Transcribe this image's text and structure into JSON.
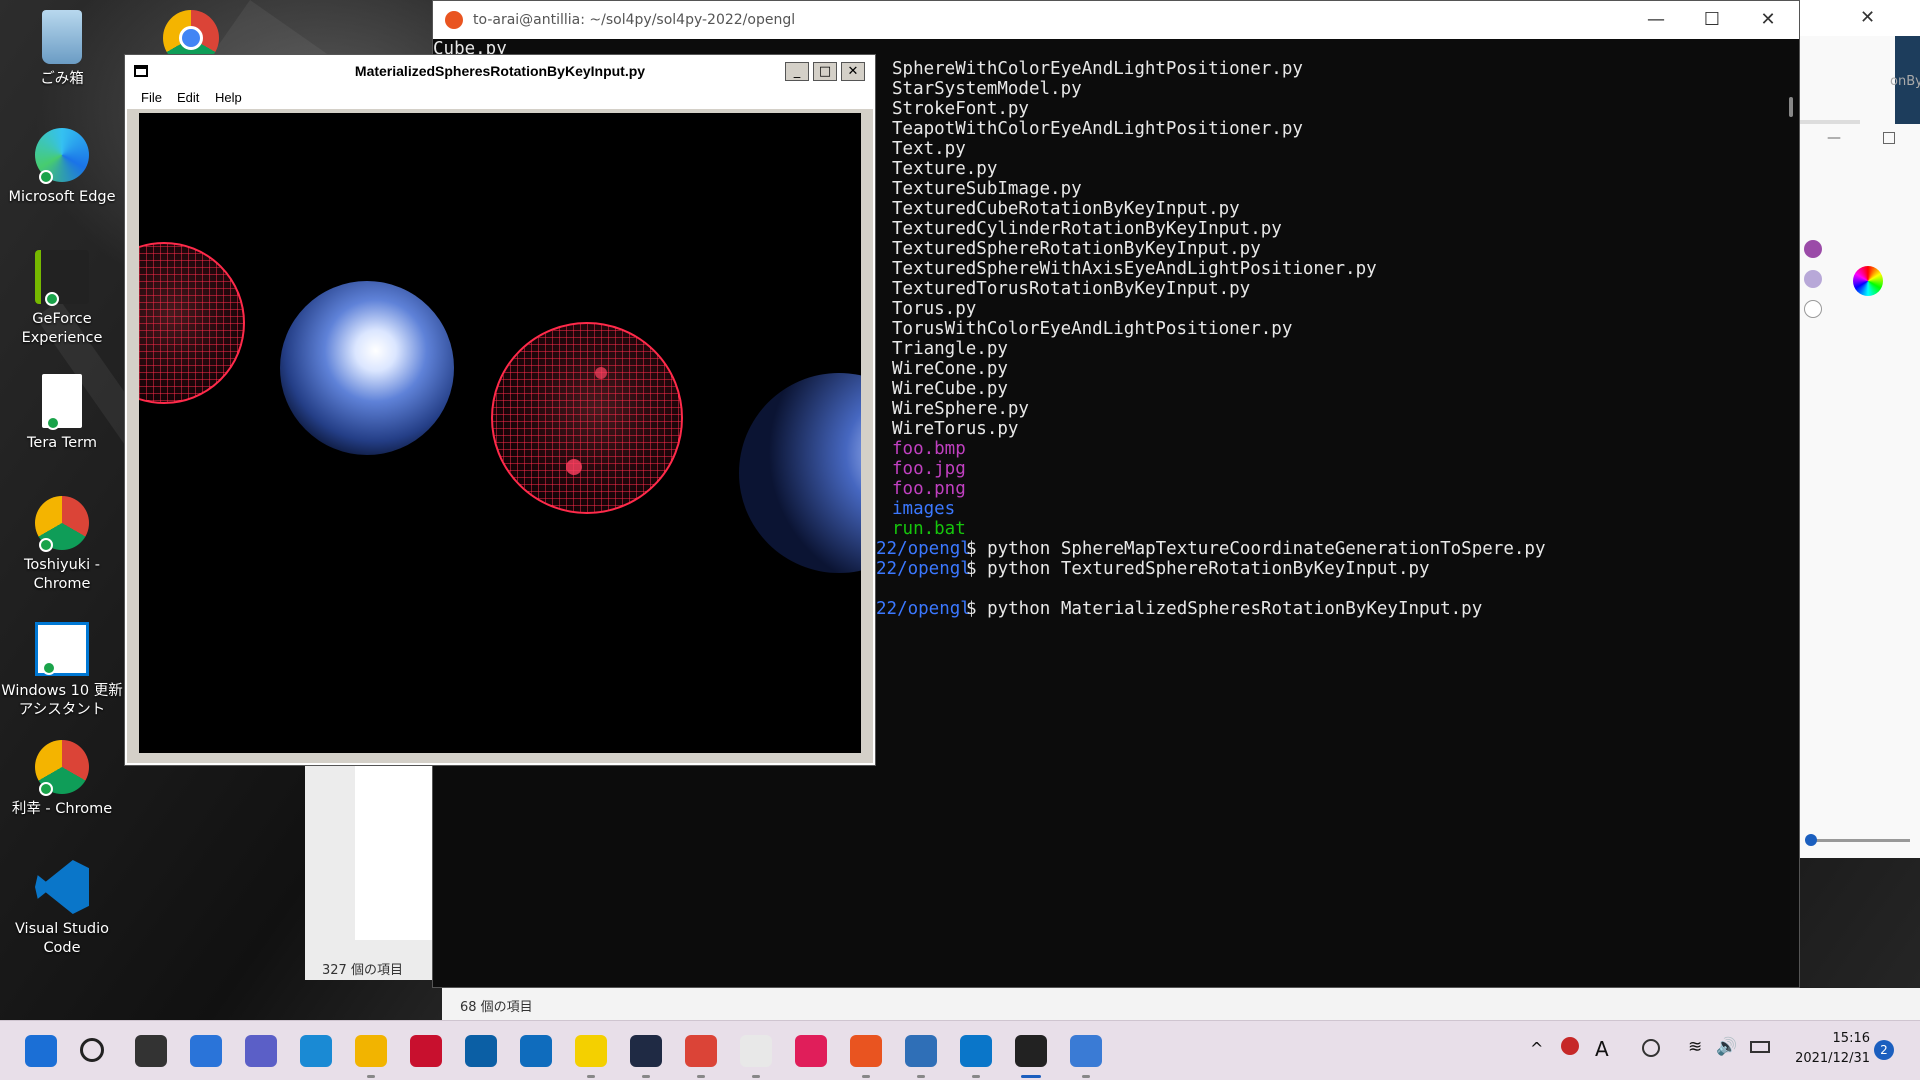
{
  "desktop": {
    "icons": [
      {
        "label": "ごみ箱",
        "icon": "recycle-bin-icon"
      },
      {
        "label": "Microsoft Edge",
        "icon": "edge-icon"
      },
      {
        "label": "GeForce\nExperience",
        "icon": "geforce-icon"
      },
      {
        "label": "Tera Term",
        "icon": "document-icon"
      },
      {
        "label": "Toshiyuki -\nChrome",
        "icon": "chrome-icon"
      },
      {
        "label": "Windows 10 更新\nアシスタント",
        "icon": "windows-update-icon"
      },
      {
        "label": "利幸 - Chrome",
        "icon": "chrome-icon"
      },
      {
        "label": "Visual Studio\nCode",
        "icon": "vscode-icon"
      }
    ]
  },
  "explorer": {
    "status_back": "327 個の項目",
    "status_front": "68 個の項目"
  },
  "terminal": {
    "title": "to-arai@antillia: ~/sol4py/sol4py-2022/opengl",
    "lines": [
      {
        "text": "Cube.py",
        "col": 0,
        "color": "#e8e8e8"
      },
      {
        "text": "SphereWithColorEyeAndLightPositioner.py",
        "col": 1,
        "color": "#e8e8e8"
      },
      {
        "text": "StarSystemModel.py",
        "col": 1,
        "color": "#e8e8e8"
      },
      {
        "text": "StrokeFont.py",
        "col": 1,
        "color": "#e8e8e8"
      },
      {
        "text": "TeapotWithColorEyeAndLightPositioner.py",
        "col": 1,
        "color": "#e8e8e8"
      },
      {
        "text": "Text.py",
        "col": 1,
        "color": "#e8e8e8"
      },
      {
        "text": "Texture.py",
        "col": 1,
        "color": "#e8e8e8"
      },
      {
        "text": "TextureSubImage.py",
        "col": 1,
        "color": "#e8e8e8"
      },
      {
        "text": "TexturedCubeRotationByKeyInput.py",
        "col": 1,
        "color": "#e8e8e8"
      },
      {
        "text": "TexturedCylinderRotationByKeyInput.py",
        "col": 1,
        "color": "#e8e8e8"
      },
      {
        "text": "TexturedSphereRotationByKeyInput.py",
        "col": 1,
        "color": "#e8e8e8"
      },
      {
        "text": "TexturedSphereWithAxisEyeAndLightPositioner.py",
        "col": 1,
        "color": "#e8e8e8"
      },
      {
        "text": "TexturedTorusRotationByKeyInput.py",
        "col": 1,
        "color": "#e8e8e8"
      },
      {
        "text": "Torus.py",
        "col": 1,
        "color": "#e8e8e8"
      },
      {
        "text": "TorusWithColorEyeAndLightPositioner.py",
        "col": 1,
        "color": "#e8e8e8"
      },
      {
        "text": "Triangle.py",
        "col": 1,
        "color": "#e8e8e8"
      },
      {
        "text": "WireCone.py",
        "col": 1,
        "color": "#e8e8e8"
      },
      {
        "text": "WireCube.py",
        "col": 1,
        "color": "#e8e8e8"
      },
      {
        "text": "WireSphere.py",
        "col": 1,
        "color": "#e8e8e8"
      },
      {
        "text": "WireTorus.py",
        "col": 1,
        "color": "#e8e8e8"
      },
      {
        "text": "foo.bmp",
        "col": 1,
        "color": "#c040c0"
      },
      {
        "text": "foo.jpg",
        "col": 1,
        "color": "#c040c0"
      },
      {
        "text": "foo.png",
        "col": 1,
        "color": "#c040c0"
      },
      {
        "text": "images",
        "col": 1,
        "color": "#3b78ff"
      },
      {
        "text": "run.bat",
        "col": 1,
        "color": "#16c60c"
      }
    ],
    "prompt_path": "22/opengl",
    "commands": [
      "$ python SphereMapTextureCoordinateGenerationToSpere.py",
      "$ python TexturedSphereRotationByKeyInput.py",
      "",
      "$ python MaterializedSpheresRotationByKeyInput.py"
    ],
    "right_fragment": "onBy"
  },
  "glwindow": {
    "title": "MaterializedSpheresRotationByKeyInput.py",
    "menu": [
      "File",
      "Edit",
      "Help"
    ],
    "buttons": [
      "_",
      "□",
      "✕"
    ]
  },
  "colors": {
    "wire_sphere": "#ff2a4a",
    "solid_sphere": "#4a6fd0",
    "palette": [
      "#9b4ba8",
      "#b8a8d8",
      "#ffffff"
    ]
  },
  "taskbar": {
    "apps": [
      "start-icon",
      "search-icon",
      "task-view-icon",
      "widgets-icon",
      "chat-icon",
      "edge-icon",
      "file-explorer-icon",
      "mcafee-icon",
      "dell-icon",
      "store-icon",
      "sticky-notes-icon",
      "terminal-icon",
      "chrome-icon",
      "notepad-icon",
      "slack-icon",
      "ubuntu-icon",
      "notepad2-icon",
      "vscode-icon",
      "linux-icon",
      "python-icon"
    ],
    "time": "15:16",
    "date": "2021/12/31",
    "notification_count": "2",
    "ime": "A"
  }
}
